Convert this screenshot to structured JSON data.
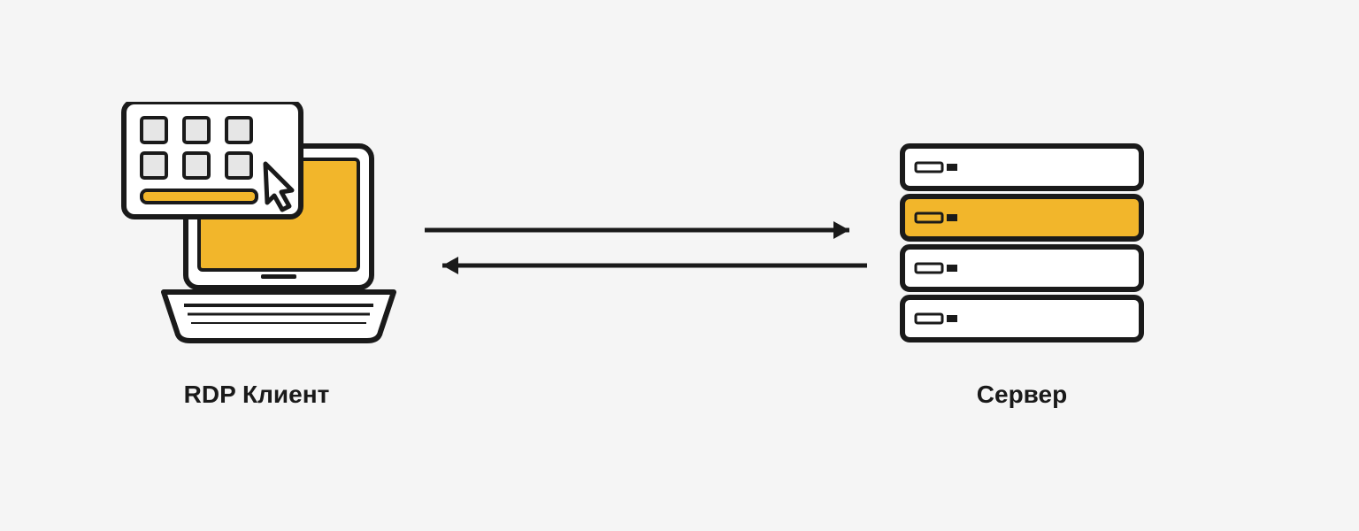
{
  "labels": {
    "client": "RDP Клиент",
    "server": "Сервер"
  },
  "colors": {
    "stroke": "#1a1a1a",
    "accent": "#f2b62b",
    "light": "#e6e6e6",
    "bg": "#f5f5f5",
    "white": "#ffffff"
  },
  "diagram": {
    "directions": [
      "client_to_server",
      "server_to_client"
    ],
    "client": "laptop with app-window overlay and cursor",
    "server": "rack of four server units, second highlighted"
  }
}
